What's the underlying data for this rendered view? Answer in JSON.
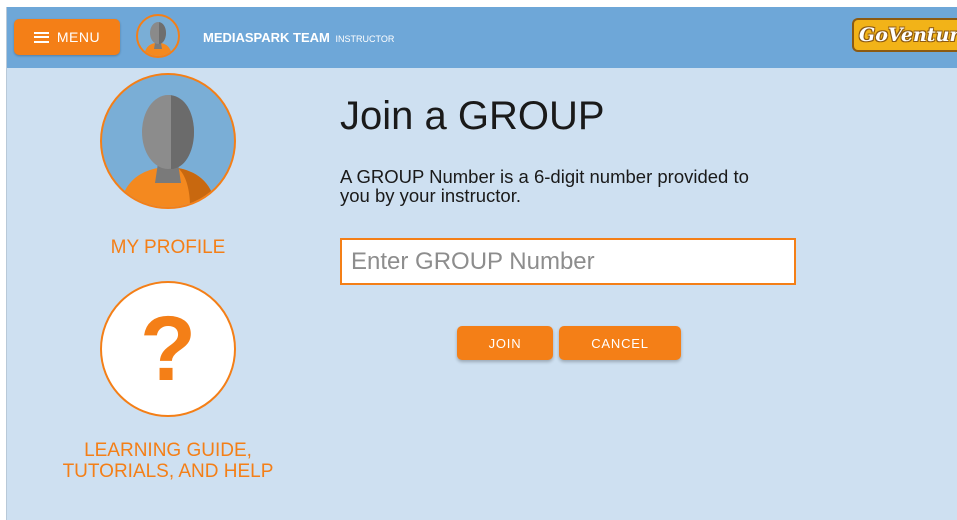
{
  "header": {
    "menu_label": "MENU",
    "team_name": "MEDIASPARK TEAM",
    "team_role": "INSTRUCTOR",
    "logo_text": "GoVenture"
  },
  "sidebar": {
    "profile_label": "MY PROFILE",
    "help_icon_glyph": "?",
    "help_label": "LEARNING GUIDE, TUTORIALS, AND HELP"
  },
  "main": {
    "title": "Join a GROUP",
    "description": "A GROUP Number is a 6-digit number provided to you by your instructor.",
    "input_placeholder": "Enter GROUP Number",
    "input_value": "",
    "join_label": "JOIN",
    "cancel_label": "CANCEL"
  },
  "colors": {
    "accent": "#f47f17",
    "topbar": "#6ea7d8",
    "background": "#cee0f1"
  },
  "icons": [
    "hamburger-icon",
    "avatar-icon",
    "help-question-icon",
    "goventure-logo"
  ]
}
